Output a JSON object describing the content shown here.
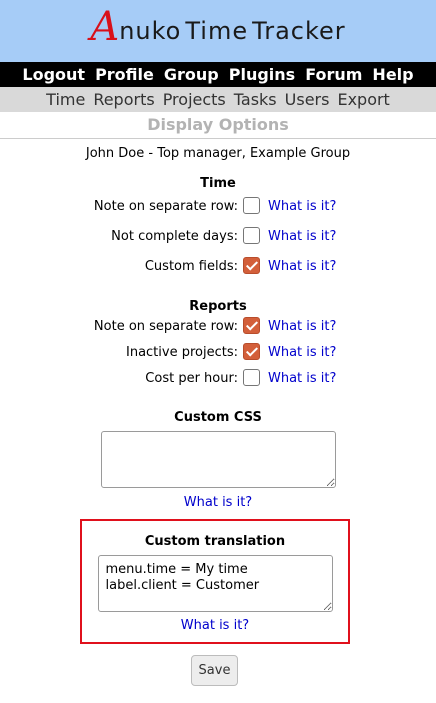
{
  "banner": {
    "logo_letter": "A",
    "word1_rest": "nuko",
    "word2": "Time",
    "word3": "Tracker"
  },
  "top_menu": [
    "Logout",
    "Profile",
    "Group",
    "Plugins",
    "Forum",
    "Help"
  ],
  "sub_menu": [
    "Time",
    "Reports",
    "Projects",
    "Tasks",
    "Users",
    "Export"
  ],
  "page_title": "Display Options",
  "user_line": "John Doe - Top manager, Example Group",
  "time_section": {
    "title": "Time",
    "rows": [
      {
        "label": "Note on separate row:",
        "checked": false,
        "help": "What is it?"
      },
      {
        "label": "Not complete days:",
        "checked": false,
        "help": "What is it?"
      },
      {
        "label": "Custom fields:",
        "checked": true,
        "help": "What is it?"
      }
    ]
  },
  "reports_section": {
    "title": "Reports",
    "rows": [
      {
        "label": "Note on separate row:",
        "checked": true,
        "help": "What is it?"
      },
      {
        "label": "Inactive projects:",
        "checked": true,
        "help": "What is it?"
      },
      {
        "label": "Cost per hour:",
        "checked": false,
        "help": "What is it?"
      }
    ]
  },
  "custom_css": {
    "title": "Custom CSS",
    "value": "",
    "help": "What is it?"
  },
  "custom_translation": {
    "title": "Custom translation",
    "value": "menu.time = My time\nlabel.client = Customer",
    "help": "What is it?"
  },
  "save_label": "Save",
  "colors": {
    "banner": "#a6ccf7",
    "logo": "#d8101a",
    "link": "#0000cc",
    "checkbox_checked": "#d35f3a",
    "highlight": "#e0101c"
  }
}
